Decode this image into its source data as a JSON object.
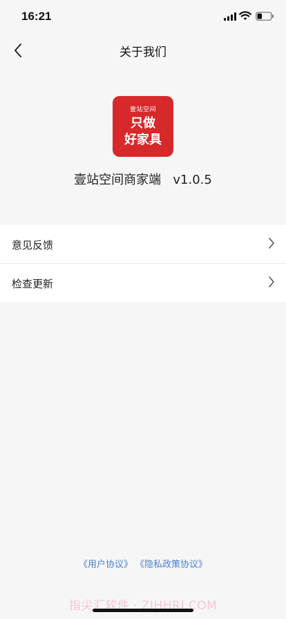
{
  "status_bar": {
    "time": "16:21",
    "icons": [
      "signal-icon",
      "wifi-icon",
      "battery-icon"
    ],
    "battery_level": 0.35
  },
  "nav": {
    "title": "关于我们",
    "back_icon": "chevron-left-icon"
  },
  "app": {
    "logo_small_text": "壹站空间",
    "logo_line1": "只做",
    "logo_line2": "好家具",
    "logo_color": "#d7282a",
    "name": "壹站空间商家端",
    "version": "v1.0.5"
  },
  "menu": {
    "items": [
      {
        "label": "意见反馈",
        "icon": "chevron-right-icon"
      },
      {
        "label": "检查更新",
        "icon": "chevron-right-icon"
      }
    ]
  },
  "footer": {
    "user_agreement": "《用户协议》",
    "privacy_policy": "《隐私政策协议》",
    "link_color": "#4a7fcf"
  },
  "watermark": "指尖汇软件 · ZJHHRJ.COM"
}
